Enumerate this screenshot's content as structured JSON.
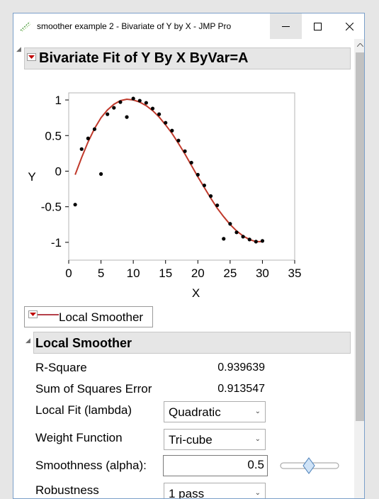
{
  "window": {
    "title": "smoother example 2 - Bivariate of Y by X - JMP Pro"
  },
  "report": {
    "title": "Bivariate Fit of Y By X ByVar=A"
  },
  "chart_data": {
    "type": "scatter",
    "xlabel": "X",
    "ylabel": "Y",
    "xlim": [
      0,
      35
    ],
    "ylim": [
      -1.25,
      1.1
    ],
    "x_ticks": [
      "0",
      "5",
      "10",
      "15",
      "20",
      "25",
      "30",
      "35"
    ],
    "y_ticks": [
      "1",
      "0.5",
      "0",
      "-0.5",
      "-1"
    ],
    "grid": false,
    "points": [
      [
        1,
        -0.47
      ],
      [
        2,
        0.31
      ],
      [
        3,
        0.46
      ],
      [
        4,
        0.59
      ],
      [
        5,
        -0.04
      ],
      [
        6,
        0.8
      ],
      [
        7,
        0.89
      ],
      [
        8,
        0.97
      ],
      [
        9,
        0.76
      ],
      [
        10,
        1.02
      ],
      [
        11,
        0.99
      ],
      [
        12,
        0.96
      ],
      [
        13,
        0.88
      ],
      [
        14,
        0.8
      ],
      [
        15,
        0.68
      ],
      [
        16,
        0.57
      ],
      [
        17,
        0.43
      ],
      [
        18,
        0.28
      ],
      [
        19,
        0.12
      ],
      [
        20,
        -0.05
      ],
      [
        21,
        -0.2
      ],
      [
        22,
        -0.35
      ],
      [
        23,
        -0.48
      ],
      [
        24,
        -0.95
      ],
      [
        25,
        -0.74
      ],
      [
        26,
        -0.86
      ],
      [
        27,
        -0.92
      ],
      [
        28,
        -0.96
      ],
      [
        29,
        -0.99
      ],
      [
        30,
        -0.98
      ]
    ],
    "smoother": [
      [
        1,
        -0.05
      ],
      [
        2,
        0.19
      ],
      [
        3,
        0.41
      ],
      [
        4,
        0.6
      ],
      [
        5,
        0.75
      ],
      [
        6,
        0.86
      ],
      [
        7,
        0.94
      ],
      [
        8,
        0.99
      ],
      [
        9,
        1.01
      ],
      [
        10,
        1.0
      ],
      [
        11,
        0.97
      ],
      [
        12,
        0.92
      ],
      [
        13,
        0.85
      ],
      [
        14,
        0.76
      ],
      [
        15,
        0.65
      ],
      [
        16,
        0.53
      ],
      [
        17,
        0.39
      ],
      [
        18,
        0.24
      ],
      [
        19,
        0.08
      ],
      [
        20,
        -0.08
      ],
      [
        21,
        -0.23
      ],
      [
        22,
        -0.38
      ],
      [
        23,
        -0.52
      ],
      [
        24,
        -0.64
      ],
      [
        25,
        -0.75
      ],
      [
        26,
        -0.84
      ],
      [
        27,
        -0.91
      ],
      [
        28,
        -0.96
      ],
      [
        29,
        -0.99
      ],
      [
        30,
        -0.99
      ]
    ],
    "point_color": "#000000",
    "smoother_color": "#c0392b"
  },
  "legend": {
    "label": "Local Smoother",
    "line_color": "#b5404a"
  },
  "local_smoother": {
    "title": "Local Smoother",
    "r_square_label": "R-Square",
    "r_square_value": "0.939639",
    "sse_label": "Sum of Squares Error",
    "sse_value": "0.913547",
    "local_fit_label": "Local Fit (lambda)",
    "local_fit_value": "Quadratic",
    "weight_label": "Weight Function",
    "weight_value": "Tri-cube",
    "smoothness_label": "Smoothness (alpha):",
    "smoothness_value": "0.5",
    "smoothness_slider_fraction": 0.5,
    "robustness_label": "Robustness",
    "robustness_value": "1 pass"
  },
  "colors": {
    "header_bg": "#e6e6e6",
    "red_triangle": "#c00000",
    "accent_border": "#7a9fc9"
  }
}
